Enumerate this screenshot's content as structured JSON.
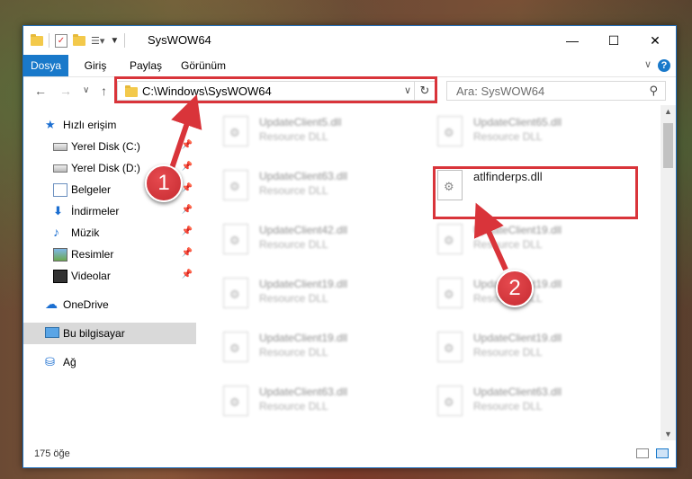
{
  "window": {
    "title": "SysWOW64",
    "minimize_glyph": "—",
    "maximize_glyph": "☐",
    "close_glyph": "✕"
  },
  "ribbon": {
    "tabs": [
      {
        "label": "Dosya",
        "active": true
      },
      {
        "label": "Giriş",
        "active": false
      },
      {
        "label": "Paylaş",
        "active": false
      },
      {
        "label": "Görünüm",
        "active": false
      }
    ]
  },
  "navigation": {
    "address_path": "C:\\Windows\\SysWOW64",
    "search_placeholder": "Ara: SysWOW64"
  },
  "sidebar": {
    "items": [
      {
        "label": "Hızlı erişim",
        "icon": "star-icon"
      },
      {
        "label": "Yerel Disk (C:)",
        "icon": "drive-icon",
        "pinned": true
      },
      {
        "label": "Yerel Disk (D:)",
        "icon": "drive-icon",
        "pinned": true
      },
      {
        "label": "Belgeler",
        "icon": "documents-icon",
        "pinned": true
      },
      {
        "label": "İndirmeler",
        "icon": "download-icon",
        "pinned": true
      },
      {
        "label": "Müzik",
        "icon": "music-icon",
        "pinned": true
      },
      {
        "label": "Resimler",
        "icon": "pictures-icon",
        "pinned": true
      },
      {
        "label": "Videolar",
        "icon": "video-icon",
        "pinned": true
      },
      {
        "label": "OneDrive",
        "icon": "cloud-icon"
      },
      {
        "label": "Bu bilgisayar",
        "icon": "computer-icon",
        "selected": true
      },
      {
        "label": "Ağ",
        "icon": "network-icon"
      }
    ]
  },
  "files": {
    "left_column": [
      {
        "name": "UpdateClient5.dll",
        "type": "Resource DLL"
      },
      {
        "name": "UpdateClient63.dll",
        "type": "Resource DLL"
      },
      {
        "name": "UpdateClient42.dll",
        "type": "Resource DLL"
      },
      {
        "name": "UpdateClient19.dll",
        "type": "Resource DLL"
      },
      {
        "name": "UpdateClient19.dll",
        "type": "Resource DLL"
      },
      {
        "name": "UpdateClient63.dll",
        "type": "Resource DLL"
      }
    ],
    "right_column": [
      {
        "name": "UpdateClient65.dll",
        "type": "Resource DLL"
      },
      {
        "name": "atlfinderps.dll",
        "type": "",
        "highlighted": true
      },
      {
        "name": "UpdateClient19.dll",
        "type": "Resource DLL"
      },
      {
        "name": "UpdateClient19.dll",
        "type": "Resource DLL"
      },
      {
        "name": "UpdateClient19.dll",
        "type": "Resource DLL"
      },
      {
        "name": "UpdateClient63.dll",
        "type": "Resource DLL"
      }
    ]
  },
  "status": {
    "item_count": "175 öğe"
  },
  "annotations": {
    "step1_label": "1",
    "step2_label": "2",
    "color": "#d9343a"
  }
}
